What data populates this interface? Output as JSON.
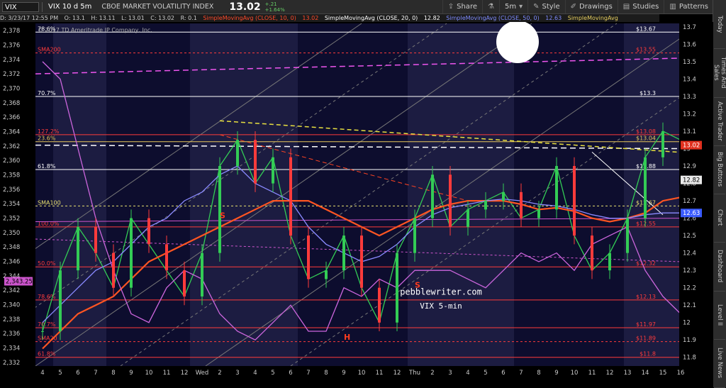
{
  "toolbar": {
    "symbol": "VIX",
    "period": "VIX 10 d 5m",
    "company": "CBOE MARKET VOLATILITY INDEX",
    "last": "13.02",
    "change_abs": "+.21",
    "change_pct": "+1.64%",
    "share_label": "Share",
    "timeframe_label": "5m",
    "style_label": "Style",
    "drawings_label": "Drawings",
    "studies_label": "Studies",
    "patterns_label": "Patterns"
  },
  "infobar": {
    "date": "D: 3/23/17 12:55 PM",
    "open": "O: 13.1",
    "high": "H: 13.11",
    "low": "L: 13.01",
    "close": "C: 13.02",
    "range": "R: 0.1",
    "sma10_label": "SimpleMovingAvg (CLOSE, 10, 0)",
    "sma10_value": "13.02",
    "sma20_label": "SimpleMovingAvg (CLOSE, 20, 0)",
    "sma20_value": "12.82",
    "sma50_label": "SimpleMovingAvg (CLOSE, 50, 0)",
    "sma50_value": "12.63",
    "sma_next_label": "SimpleMovingAvg"
  },
  "side_tabs": [
    "Today",
    "Times And Sales",
    "Active Trader",
    "Big Buttons",
    "Chart",
    "Dashboard",
    "Level II",
    "Live News"
  ],
  "chart_data": {
    "type": "line",
    "title": "VIX 5-min",
    "watermark": "pebblewriter.com",
    "copyright": "© 2017 TD Ameritrade IP Company, Inc.",
    "right_axis": {
      "min": 11.75,
      "max": 13.72,
      "ticks": [
        "13.7",
        "13.6",
        "13.5",
        "13.4",
        "13.3",
        "13.2",
        "13.1",
        "13",
        "12.9",
        "12.8",
        "12.7",
        "12.6",
        "12.5",
        "12.4",
        "12.3",
        "12.2",
        "12.1",
        "12",
        "11.9",
        "11.8"
      ]
    },
    "left_axis": {
      "min": 2331.5,
      "max": 2379,
      "ticks": [
        "2,378",
        "2,376",
        "2,374",
        "2,372",
        "2,370",
        "2,368",
        "2,366",
        "2,364",
        "2,362",
        "2,360",
        "2,358",
        "2,356",
        "2,354",
        "2,352",
        "2,350",
        "2,348",
        "2,346",
        "2,344",
        "2,342",
        "2,340",
        "2,338",
        "2,336",
        "2,334",
        "2,332"
      ]
    },
    "x_ticks": [
      "4",
      "5",
      "6",
      "7",
      "8",
      "9",
      "10",
      "11",
      "12",
      "Wed",
      "2",
      "3",
      "4",
      "5",
      "6",
      "7",
      "8",
      "9",
      "10",
      "11",
      "12",
      "Thu",
      "2",
      "3",
      "4",
      "5",
      "6",
      "7",
      "8",
      "9",
      "10",
      "11",
      "12",
      "13",
      "14",
      "15",
      "16"
    ],
    "levels": [
      {
        "left_label": "78.6%",
        "right_label": "$13.67",
        "value": 13.67,
        "color": "#ffffff",
        "dash": ""
      },
      {
        "left_label": "SMA200",
        "right_label": "$13.55",
        "value": 13.55,
        "color": "#ff3b3b",
        "dash": "3,3"
      },
      {
        "left_label": "70.7%",
        "right_label": "$13.3",
        "value": 13.3,
        "color": "#ffffff",
        "dash": ""
      },
      {
        "left_label": "127.2%",
        "right_label": "$13.08",
        "value": 13.08,
        "color": "#ff3b3b",
        "dash": ""
      },
      {
        "left_label": "23.6%",
        "right_label": "$13.04",
        "value": 13.04,
        "color": "#e8c85a",
        "dash": ""
      },
      {
        "left_label": "61.8%",
        "right_label": "$12.88",
        "value": 12.88,
        "color": "#ffffff",
        "dash": ""
      },
      {
        "left_label": "SMA100",
        "right_label": "$12.67",
        "value": 12.67,
        "color": "#e8e070",
        "dash": "3,3"
      },
      {
        "left_label": "100.0%",
        "right_label": "$12.55",
        "value": 12.55,
        "color": "#ff3b3b",
        "dash": ""
      },
      {
        "left_label": "50.0%",
        "right_label": "$12.32",
        "value": 12.32,
        "color": "#ff3b3b",
        "dash": ""
      },
      {
        "left_label": "78.6%",
        "right_label": "$12.13",
        "value": 12.13,
        "color": "#ff3b3b",
        "dash": ""
      },
      {
        "left_label": "70.7%",
        "right_label": "$11.97",
        "value": 11.97,
        "color": "#ff3b3b",
        "dash": ""
      },
      {
        "left_label": "SMA20",
        "right_label": "$11.89",
        "value": 11.89,
        "color": "#ff3b3b",
        "dash": "3,3"
      },
      {
        "left_label": "61.8%",
        "right_label": "$11.8",
        "value": 11.8,
        "color": "#ff3b3b",
        "dash": ""
      }
    ],
    "price_badges": [
      {
        "label": "13.02",
        "value": 13.02,
        "color": "#e0301e"
      },
      {
        "label": "12.82",
        "value": 12.82,
        "color": "#e8e8e8"
      },
      {
        "label": "12.63",
        "value": 12.63,
        "color": "#3a5bff"
      }
    ],
    "left_badge": {
      "label": "2,343.25",
      "value": 2343.25
    },
    "annotations": [
      {
        "text": "S",
        "x_index": 10,
        "value": 12.6,
        "color": "#ff3b1e"
      },
      {
        "text": "S",
        "x_index": 21,
        "value": 12.2,
        "color": "#ff3b1e"
      },
      {
        "text": "H",
        "x_index": 17,
        "value": 11.9,
        "color": "#ff3b1e"
      }
    ],
    "series": [
      {
        "name": "price",
        "color": "#33cc55",
        "values": [
          11.95,
          12.3,
          12.55,
          12.4,
          12.2,
          12.6,
          12.45,
          12.3,
          12.15,
          12.4,
          12.9,
          13.05,
          12.8,
          12.95,
          12.5,
          12.25,
          12.3,
          12.5,
          12.2,
          12.0,
          12.4,
          12.6,
          12.85,
          12.55,
          12.65,
          12.7,
          12.75,
          12.6,
          12.65,
          12.9,
          12.5,
          12.3,
          12.4,
          12.6,
          12.95,
          13.1,
          13.05
        ]
      },
      {
        "name": "sma20",
        "color": "#ff5522",
        "values": [
          11.85,
          11.95,
          12.05,
          12.1,
          12.15,
          12.25,
          12.35,
          12.4,
          12.45,
          12.5,
          12.55,
          12.6,
          12.65,
          12.7,
          12.7,
          12.7,
          12.65,
          12.6,
          12.55,
          12.5,
          12.55,
          12.6,
          12.65,
          12.68,
          12.7,
          12.7,
          12.7,
          12.68,
          12.65,
          12.66,
          12.64,
          12.6,
          12.58,
          12.6,
          12.63,
          12.7,
          12.72
        ]
      },
      {
        "name": "sma50",
        "color": "#8a8aff",
        "values": [
          12.0,
          12.1,
          12.2,
          12.3,
          12.35,
          12.45,
          12.55,
          12.6,
          12.7,
          12.75,
          12.85,
          12.9,
          12.8,
          12.75,
          12.7,
          12.55,
          12.45,
          12.4,
          12.35,
          12.38,
          12.45,
          12.55,
          12.62,
          12.66,
          12.68,
          12.7,
          12.71,
          12.7,
          12.68,
          12.67,
          12.65,
          12.62,
          12.6,
          12.6,
          12.62,
          12.63,
          12.63
        ]
      },
      {
        "name": "spx",
        "color": "#cc66dd",
        "values": [
          13.5,
          13.4,
          13.0,
          12.6,
          12.3,
          12.05,
          12.0,
          12.2,
          12.3,
          12.25,
          12.05,
          11.95,
          11.9,
          12.0,
          12.1,
          11.95,
          11.95,
          12.2,
          12.15,
          12.25,
          12.2,
          12.3,
          12.3,
          12.3,
          12.25,
          12.2,
          12.3,
          12.4,
          12.35,
          12.4,
          12.3,
          12.45,
          12.5,
          12.55,
          12.3,
          12.15,
          12.05
        ]
      }
    ]
  }
}
